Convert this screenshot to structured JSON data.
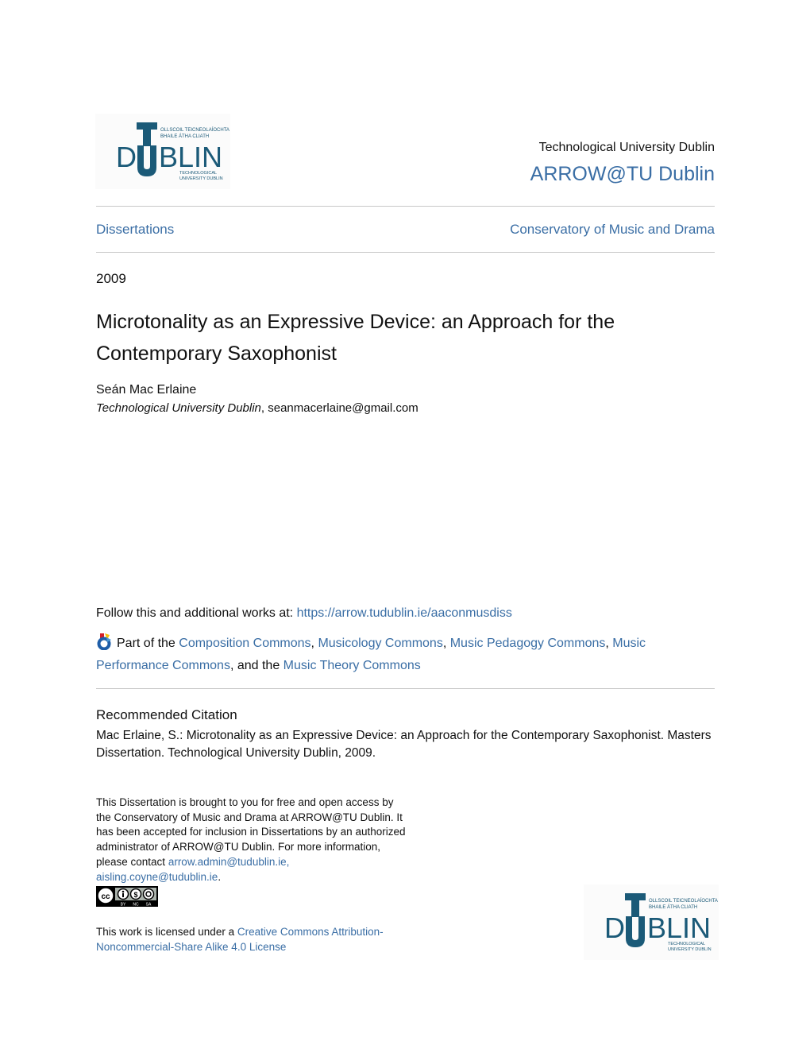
{
  "header": {
    "logo": {
      "icon": "tu-dublin-logo",
      "letters_left": "D",
      "letter_t": "T",
      "letter_u": "U",
      "letters_right": "BLIN",
      "line1": "OLLSCOIL TEICNEOLAÍOCHTA",
      "line2": "BHAILE ÁTHA CLIATH",
      "line3": "TECHNOLOGICAL",
      "line4": "UNIVERSITY DUBLIN",
      "color": "#1b5a78"
    },
    "institution": "Technological University Dublin",
    "repository": "ARROW@TU Dublin"
  },
  "breadcrumb": {
    "left": "Dissertations",
    "right": "Conservatory of Music and Drama"
  },
  "year": "2009",
  "title": "Microtonality as an Expressive Device: an Approach for the Contemporary Saxophonist",
  "author": {
    "name": "Seán Mac Erlaine",
    "affiliation": "Technological University Dublin",
    "email": "seanmacerlaine@gmail.com"
  },
  "follow": {
    "label": "Follow this and additional works at: ",
    "url": "https://arrow.tudublin.ie/aaconmusdiss"
  },
  "part_of": {
    "icon": "bepress-commons-icon",
    "prefix": "Part of the ",
    "links": [
      "Composition Commons",
      "Musicology Commons",
      "Music Pedagogy Commons",
      "Music Performance Commons",
      "Music Theory Commons"
    ],
    "sep": ", ",
    "and_the": ", and the "
  },
  "citation": {
    "heading": "Recommended Citation",
    "text": "Mac Erlaine, S.: Microtonality as an Expressive Device: an Approach for the Contemporary Saxophonist. Masters Dissertation. Technological University Dublin, 2009."
  },
  "notice": {
    "text": "This Dissertation is brought to you for free and open access by the Conservatory of Music and Drama at ARROW@TU Dublin. It has been accepted for inclusion in Dissertations by an authorized administrator of ARROW@TU Dublin. For more information, please contact ",
    "email1": "arrow.admin@tudublin.ie,",
    "email2": "aisling.coyne@tudublin.ie",
    "end": "."
  },
  "cc_badge": {
    "icon": "cc-by-nc-sa-icon",
    "labels": [
      "BY",
      "NC",
      "SA"
    ],
    "cc": "cc"
  },
  "license": {
    "prefix": "This work is licensed under a ",
    "link": "Creative Commons Attribution-Noncommercial-Share Alike 4.0 License"
  },
  "colors": {
    "link": "#3a6ea5",
    "logo": "#1b5a78",
    "rule": "#c8c8c8"
  }
}
